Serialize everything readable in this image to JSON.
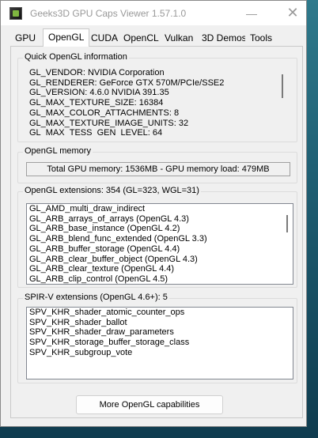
{
  "window": {
    "title": "Geeks3D GPU Caps Viewer 1.57.1.0",
    "minimize_glyph": "—",
    "close_glyph": "✕"
  },
  "tabs": [
    {
      "label": "GPU"
    },
    {
      "label": "OpenGL"
    },
    {
      "label": "CUDA"
    },
    {
      "label": "OpenCL"
    },
    {
      "label": "Vulkan"
    },
    {
      "label": "3D Demos"
    },
    {
      "label": "Tools"
    }
  ],
  "active_tab": "OpenGL",
  "quick_info": {
    "label": "Quick OpenGL information",
    "lines": [
      "GL_VENDOR: NVIDIA Corporation",
      "GL_RENDERER: GeForce GTX 570M/PCIe/SSE2",
      "GL_VERSION: 4.6.0 NVIDIA 391.35",
      "GL_MAX_TEXTURE_SIZE: 16384",
      "GL_MAX_COLOR_ATTACHMENTS: 8",
      "GL_MAX_TEXTURE_IMAGE_UNITS: 32",
      "GL_MAX_TESS_GEN_LEVEL: 64"
    ]
  },
  "memory": {
    "label": "OpenGL memory",
    "text": "Total GPU memory: 1536MB - GPU memory load: 479MB"
  },
  "extensions": {
    "label": "OpenGL extensions: 354 (GL=323, WGL=31)",
    "items": [
      "GL_AMD_multi_draw_indirect",
      "GL_ARB_arrays_of_arrays (OpenGL 4.3)",
      "GL_ARB_base_instance (OpenGL 4.2)",
      "GL_ARB_blend_func_extended (OpenGL 3.3)",
      "GL_ARB_buffer_storage (OpenGL 4.4)",
      "GL_ARB_clear_buffer_object (OpenGL 4.3)",
      "GL_ARB_clear_texture (OpenGL 4.4)",
      "GL_ARB_clip_control (OpenGL 4.5)"
    ]
  },
  "spirv": {
    "label": "SPIR-V extensions (OpenGL 4.6+): 5",
    "items": [
      "SPV_KHR_shader_atomic_counter_ops",
      "SPV_KHR_shader_ballot",
      "SPV_KHR_shader_draw_parameters",
      "SPV_KHR_storage_buffer_storage_class",
      "SPV_KHR_subgroup_vote"
    ]
  },
  "buttons": {
    "more_label": "More OpenGL capabilities"
  }
}
